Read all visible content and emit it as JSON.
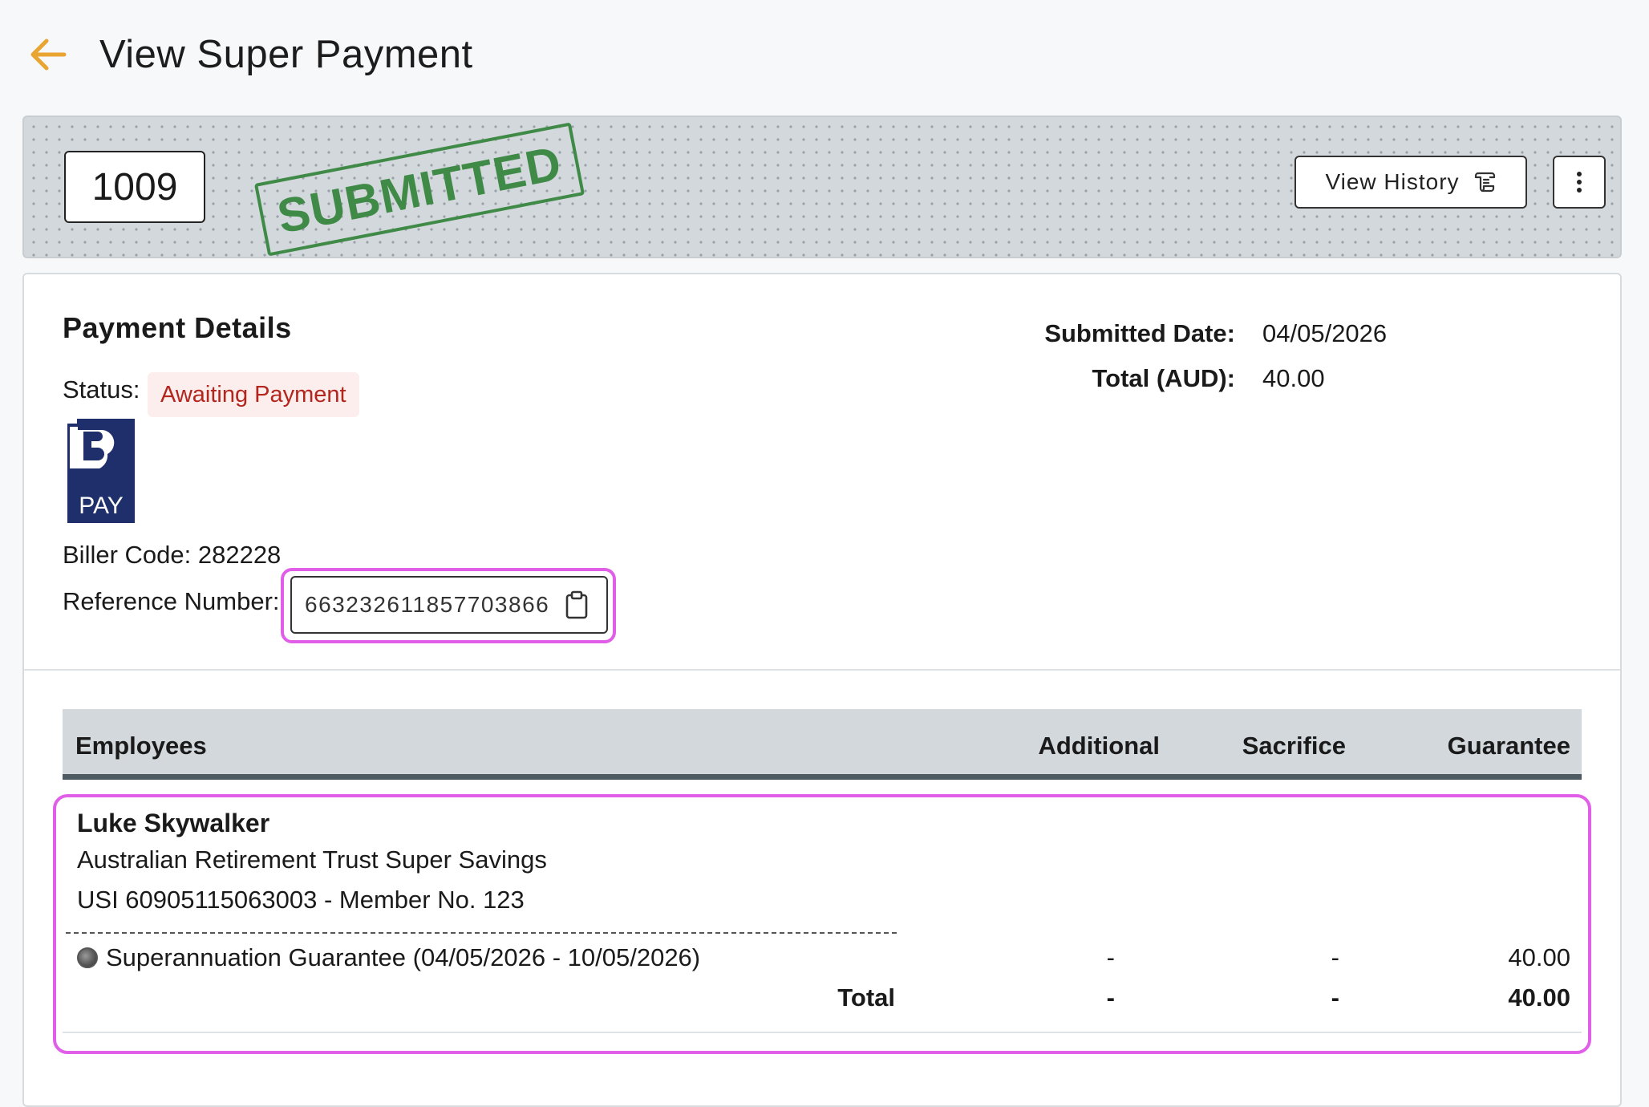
{
  "header": {
    "title": "View Super Payment",
    "back_icon": "arrow-left-icon",
    "accent_color": "#e9a531"
  },
  "banner": {
    "payment_id": "1009",
    "stamp_text": "SUBMITTED",
    "stamp_color": "#3f8a47",
    "view_history_label": "View History",
    "view_history_icon": "scroll-history-icon",
    "more_icon": "more-vertical-icon"
  },
  "details": {
    "section_title": "Payment Details",
    "status_label": "Status:",
    "status_value": "Awaiting Payment",
    "status_color": "#b3261e",
    "logo": {
      "name": "bpay-logo",
      "text": "PAY",
      "color": "#1e2f6b"
    },
    "biller_code_label": "Biller Code: 282228",
    "reference_label": "Reference Number:",
    "reference_value": "663232611857703866",
    "copy_icon": "clipboard-icon",
    "submitted_date_label": "Submitted Date:",
    "submitted_date_value": "04/05/2026",
    "total_label": "Total (AUD):",
    "total_value": "40.00"
  },
  "table": {
    "columns": [
      "Employees",
      "Additional",
      "Sacrifice",
      "Guarantee"
    ],
    "employee": {
      "name": "Luke Skywalker",
      "fund": "Australian Retirement Trust Super Savings",
      "usi_line": "USI 60905115063003 - Member No. 123",
      "line_item": {
        "description": "Superannuation Guarantee (04/05/2026 - 10/05/2026)",
        "additional": "-",
        "sacrifice": "-",
        "guarantee": "40.00"
      },
      "total": {
        "label": "Total",
        "additional": "-",
        "sacrifice": "-",
        "guarantee": "40.00"
      }
    }
  },
  "highlight_color": "#e05ee8"
}
